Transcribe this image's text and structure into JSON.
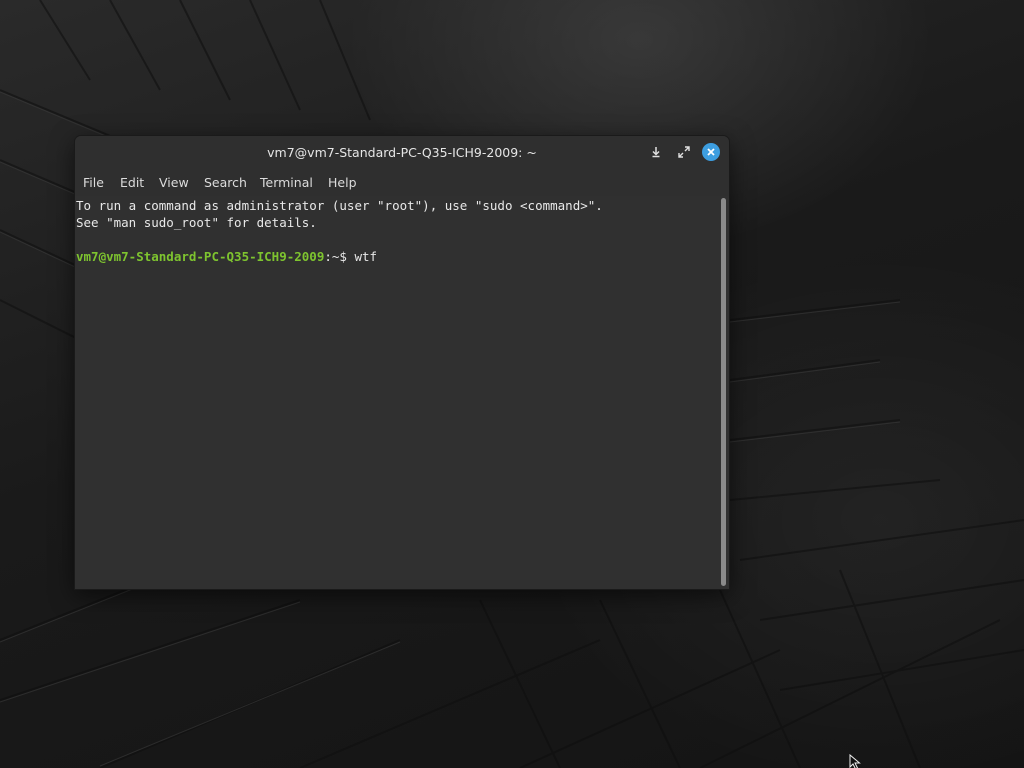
{
  "window": {
    "title": "vm7@vm7-Standard-PC-Q35-ICH9-2009: ~"
  },
  "titlebar_buttons": {
    "minimize_icon": "minimize-down-arrow-icon",
    "maximize_icon": "maximize-arrows-icon",
    "close_icon": "close-x-icon",
    "close_color": "#3d9ee0"
  },
  "menu": {
    "file": "File",
    "edit": "Edit",
    "view": "View",
    "search": "Search",
    "terminal": "Terminal",
    "help": "Help"
  },
  "terminal": {
    "line1": "To run a command as administrator (user \"root\"), use \"sudo <command>\".",
    "line2": "See \"man sudo_root\" for details.",
    "prompt_user": "vm7@vm7-Standard-PC-Q35-ICH9-2009",
    "prompt_path": ":~$ ",
    "command": "wtf",
    "prompt_color": "#7ec42f"
  }
}
